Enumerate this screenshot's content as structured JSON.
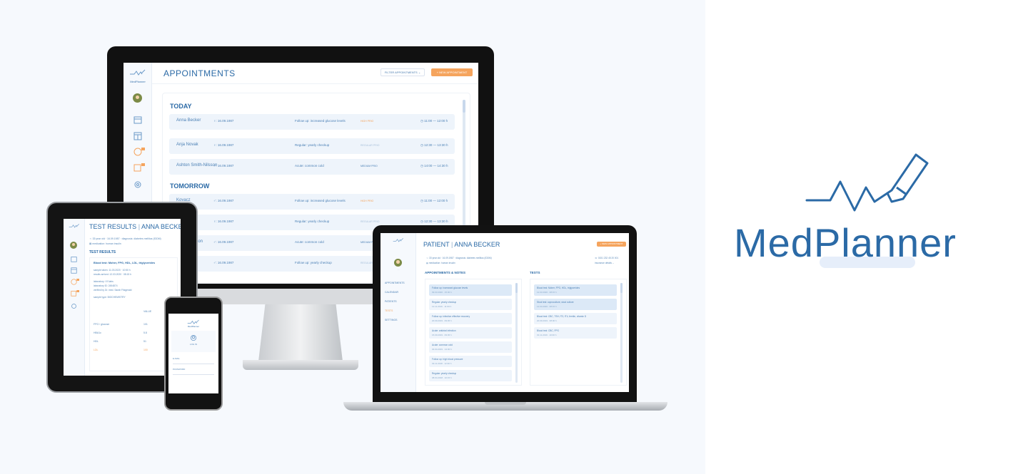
{
  "brand": {
    "name": "MedPlanner",
    "accent": "#2b6aa6",
    "underline_color": "#e6eefa"
  },
  "desktop": {
    "logo": "MedPlanner",
    "title": "APPOINTMENTS",
    "filter_label": "FILTER APPOINTMENTS ⌄",
    "new_label": "+ NEW APPOINTMENT",
    "sections": [
      {
        "title": "TODAY",
        "rows": [
          {
            "name": "Anna Becker",
            "dob": "♀: 16.09.1987",
            "reason": "Follow up: increased glucose levels",
            "prio": "HIGH PRIO",
            "time": "◷ 11:00 — 12:00 h"
          },
          {
            "name": "Anja Novak",
            "dob": "♀: 16.09.1987",
            "reason": "Regular: yearly checkup",
            "prio": "REGULAR PRIO",
            "time": "◷ 12:30 — 13:30 h"
          },
          {
            "name": "Ashton Smith-Nilsson",
            "dob": "♂: 16.09.1987",
            "reason": "Acute: common cold",
            "prio": "MEDIUM PRIO",
            "time": "◷ 14:00 — 14:30 h"
          }
        ]
      },
      {
        "title": "TOMORROW",
        "rows": [
          {
            "name": "Kovacz",
            "dob": "♂: 16.09.1987",
            "reason": "Follow up: increased glucose levels",
            "prio": "HIGH PRIO",
            "time": "◷ 11:00 — 12:00 h"
          },
          {
            "name": "k",
            "dob": "♀: 16.09.1987",
            "reason": "Regular: yearly checkup",
            "prio": "REGULAR PRIO",
            "time": "◷ 12:30 — 13:30 h"
          },
          {
            "name": "Smith-Nilsson",
            "dob": "♂: 16.09.1987",
            "reason": "Acute: common cold",
            "prio": "MEDIUM PRIO",
            "time": ""
          },
          {
            "name": "Kovacz",
            "dob": "♂: 16.09.1987",
            "reason": "Follow up: yearly checkup",
            "prio": "REGULAR PRIO",
            "time": ""
          }
        ]
      }
    ]
  },
  "tablet": {
    "title_a": "TEST RESULTS",
    "title_b": "ANNA BECKER",
    "meta1": "♀: 33 year old · 16.09.1987 · diagnosis: diabetes mellitus (IDDM)",
    "meta2": "▤ medication: human insulin",
    "section": "TEST RESULTS",
    "test_title": "Blood test: Moher, FPG, HDL, LDL, triglycerides",
    "lines": [
      "sample taken: 11.03.2020 · 10:50 h",
      "results arrived: 12.03.2020 · 08:15 h",
      "laboratory: XY-labs",
      "laboratory ID: 2454874",
      "verified by Dr. med. Sarah Fitzgerald",
      "sample type: BIOCHEMISTRY"
    ],
    "col": "VALUE",
    "rows": [
      [
        "FPG / glucose",
        "101"
      ],
      [
        "HBA1c",
        "5.8"
      ],
      [
        "HDL",
        "51"
      ],
      [
        "LDL",
        "100"
      ]
    ]
  },
  "phone": {
    "logo": "MedPlanner",
    "login": "LOG IN",
    "email": "E-MAIL",
    "password": "PASSWORD"
  },
  "laptop": {
    "title_a": "PATIENT",
    "title_b": "ANNA BECKER",
    "btn": "+ NEW APPOINTMENT",
    "meta1": "♀: 33 year old · 16.09.1987 · diagnosis: diabetes mellitus (IDDM)",
    "meta2": "▤ medication: human insulin",
    "meta3": "☏ 0151 232 45 20 001",
    "meta4": "insurance details ⌄",
    "nav": [
      "APPOINTMENTS",
      "CALENDAR",
      "PATIENTS",
      "TESTS",
      "SETTINGS"
    ],
    "col1": "APPOINTMENTS & NOTES",
    "col2": "TESTS",
    "appts": [
      {
        "t": "Follow up: increased glucose levels",
        "d": "09.03.2020 · 15:30 h"
      },
      {
        "t": "Regular: yearly checkup",
        "d": "12.11.2019 · 11:00 h"
      },
      {
        "t": "Follow up: infection effective recovery",
        "d": "20.09.2019 · 09:45 h"
      },
      {
        "t": "Acute: antiviral infection",
        "d": "15.09.2019 · 09:45 h"
      },
      {
        "t": "Acute: common cold",
        "d": "04.04.2019 · 14:30 h"
      },
      {
        "t": "Follow up: high blood pressure",
        "d": "03.11.2018 · 12:30 h"
      },
      {
        "t": "Regular: yearly checkup",
        "d": "08.04.2018 · 10:15 h"
      }
    ],
    "tests": [
      {
        "t": "Blood test: Moher, FPG, HDL, triglycerides",
        "d": "12.03.2020 · 08:15 h"
      },
      {
        "t": "Stool test: coproculture, stool culture",
        "d": "12.03.2020 · 08:15 h"
      },
      {
        "t": "Blood test: CBC, TSH, fT3, fT4, ferritin, vitamin D",
        "d": "20.09.2019 · 08:00 h"
      },
      {
        "t": "Blood test: CBC, FPG",
        "d": "01.11.2019 · 10:00 h"
      }
    ]
  }
}
